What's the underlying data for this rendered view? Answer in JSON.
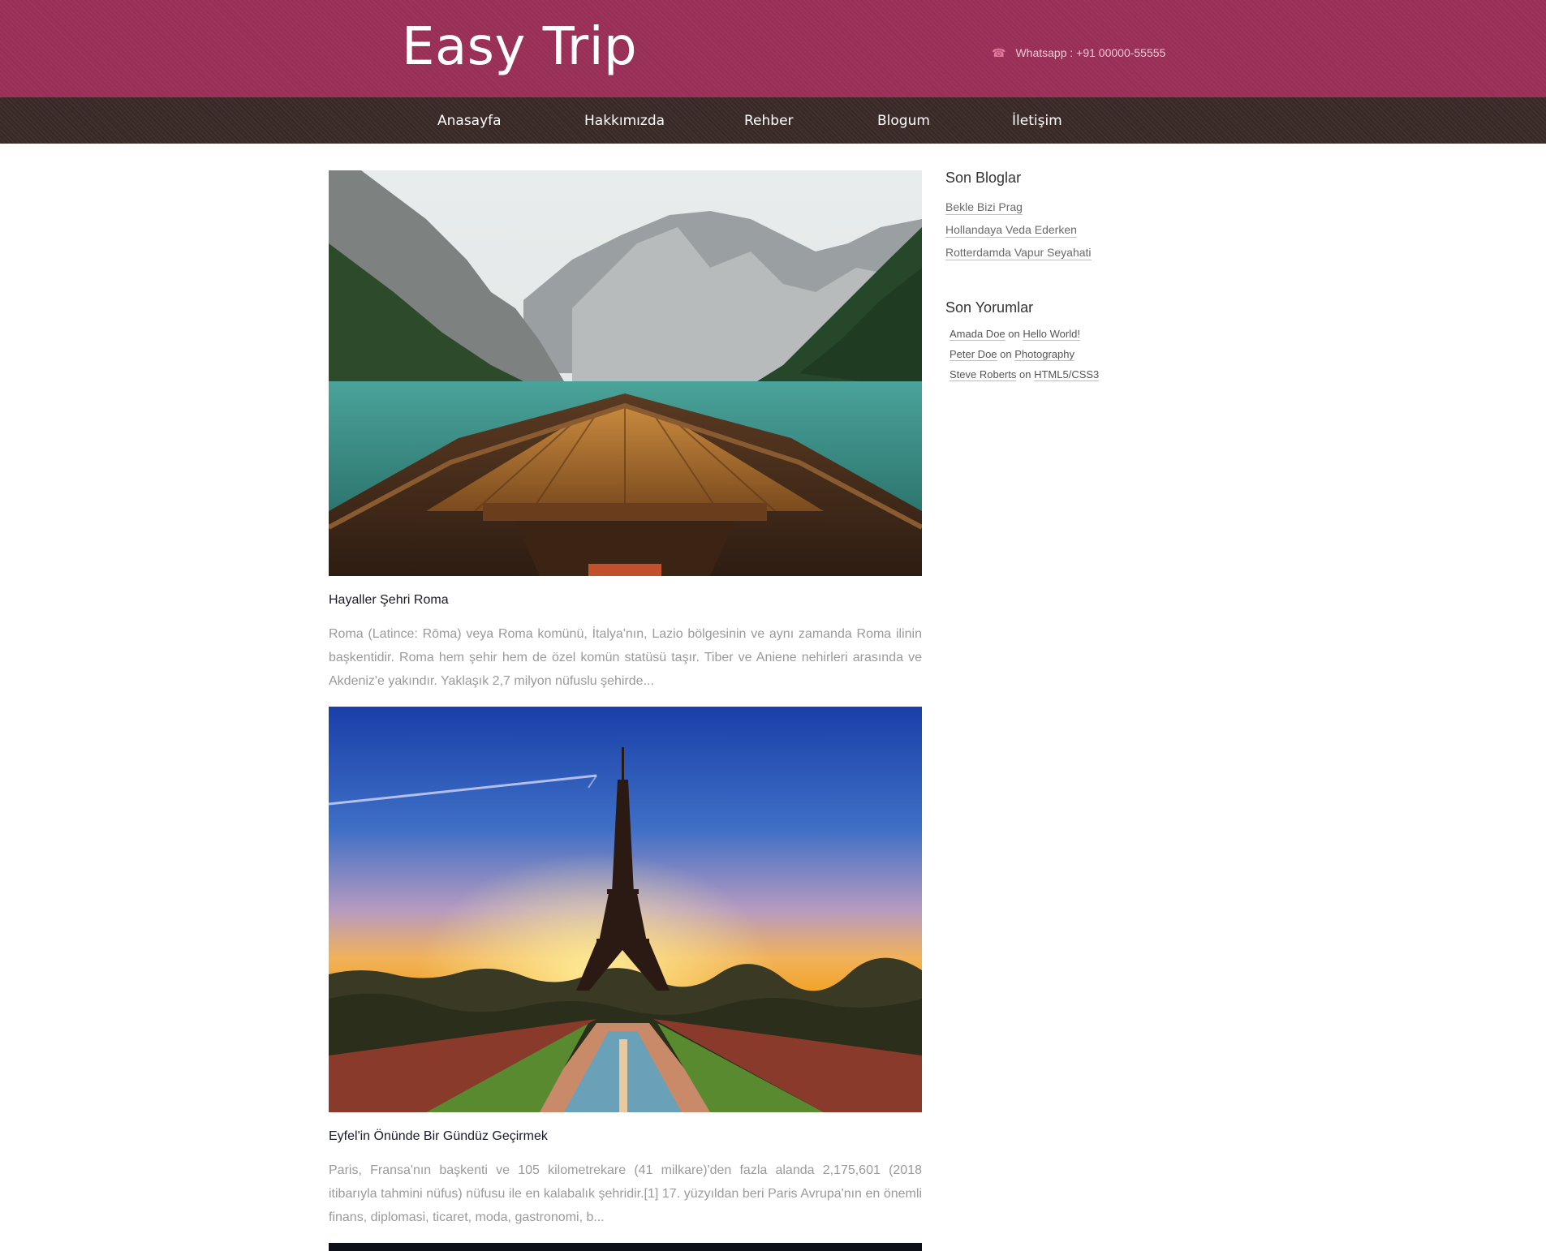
{
  "header": {
    "logo": "Easy Trip",
    "contact_icon": "phone-icon",
    "contact": "Whatsapp : +91 00000-55555"
  },
  "nav": {
    "items": [
      "Anasayfa",
      "Hakkımızda",
      "Rehber",
      "Blogum",
      "İletişim"
    ]
  },
  "posts": [
    {
      "title": "Hayaller Şehri Roma",
      "excerpt": "Roma (Latince: Rōma) veya Roma komünü, İtalya'nın, Lazio bölgesinin ve aynı zamanda Roma ilinin başkentidir. Roma hem şehir hem de özel komün statüsü taşır. Tiber ve Aniene nehirleri arasında ve Akdeniz'e yakındır. Yaklaşık 2,7 milyon nüfuslu şehirde..."
    },
    {
      "title": "Eyfel'in Önünde Bir Gündüz Geçirmek",
      "excerpt": "Paris, Fransa'nın başkenti ve 105 kilometrekare (41 milkare)'den fazla alanda 2,175,601 (2018 itibarıyla tahmini nüfus) nüfusu ile en kalabalık şehridir.[1] 17. yüzyıldan beri Paris Avrupa'nın en önemli finans, diplomasi, ticaret, moda, gastronomi, b..."
    }
  ],
  "sidebar": {
    "blogs_title": "Son Bloglar",
    "blogs": [
      "Bekle Bizi Prag",
      "Hollandaya Veda Ederken",
      "Rotterdamda Vapur Seyahati"
    ],
    "comments_title": "Son Yorumlar",
    "comments": [
      {
        "author": "Amada Doe",
        "on": "on",
        "post": "Hello World!"
      },
      {
        "author": "Peter Doe",
        "on": "on",
        "post": "Photography"
      },
      {
        "author": "Steve Roberts",
        "on": "on",
        "post": "HTML5/CSS3"
      }
    ]
  },
  "colors": {
    "header": "#9b2f57",
    "nav": "#3a2a28",
    "text": "#9a9a9a"
  }
}
